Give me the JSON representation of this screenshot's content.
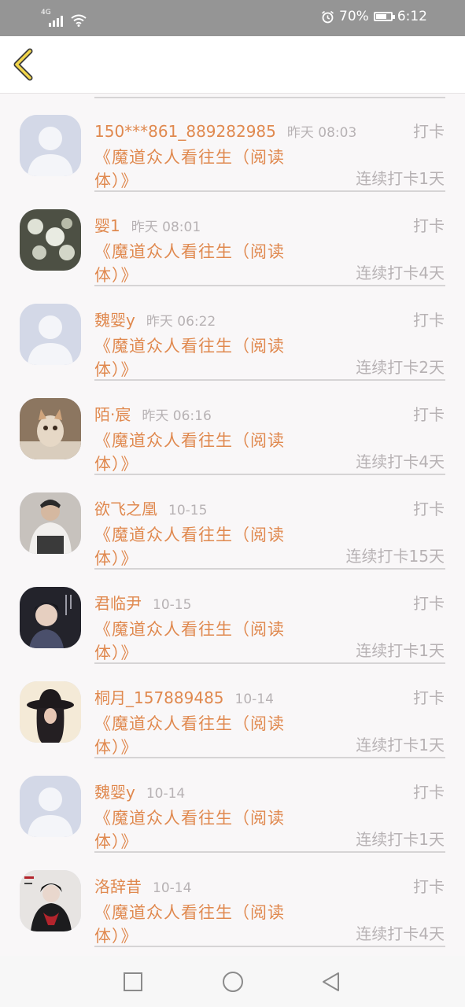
{
  "status_bar": {
    "network": "4G",
    "battery_text": "70%",
    "battery_level": 0.7,
    "time": "6:12",
    "icons": [
      "signal-icon",
      "wifi-icon",
      "alarm-icon",
      "battery-icon"
    ]
  },
  "header": {
    "back_icon": "chevron-left-icon"
  },
  "colors": {
    "accent_orange": "#e0894f",
    "muted_gray": "#b7b2b4",
    "background": "#f9f7f8",
    "back_icon_yellow": "#f2d64b"
  },
  "records": [
    {
      "name": "150***861_889282985",
      "time": "昨天 08:03",
      "action": "打卡",
      "book": "《魔道众人看往生（阅读体）》",
      "streak": "连续打卡1天",
      "avatar": "default-avatar"
    },
    {
      "name": "婴1",
      "time": "昨天 08:01",
      "action": "打卡",
      "book": "《魔道众人看往生（阅读体）》",
      "streak": "连续打卡4天",
      "avatar": "flowers-avatar"
    },
    {
      "name": "魏婴y",
      "time": "昨天 06:22",
      "action": "打卡",
      "book": "《魔道众人看往生（阅读体）》",
      "streak": "连续打卡2天",
      "avatar": "default-avatar"
    },
    {
      "name": "陌·宸",
      "time": "昨天 06:16",
      "action": "打卡",
      "book": "《魔道众人看往生（阅读体）》",
      "streak": "连续打卡4天",
      "avatar": "kitten-avatar"
    },
    {
      "name": "欲飞之凰",
      "time": "10-15",
      "action": "打卡",
      "book": "《魔道众人看往生（阅读体）》",
      "streak": "连续打卡15天",
      "avatar": "person-white-hoodie-avatar"
    },
    {
      "name": "君临尹",
      "time": "10-15",
      "action": "打卡",
      "book": "《魔道众人看往生（阅读体）》",
      "streak": "连续打卡1天",
      "avatar": "person-dark-avatar"
    },
    {
      "name": "桐月_157889485",
      "time": "10-14",
      "action": "打卡",
      "book": "《魔道众人看往生（阅读体）》",
      "streak": "连续打卡1天",
      "avatar": "hat-woman-avatar"
    },
    {
      "name": "魏婴y",
      "time": "10-14",
      "action": "打卡",
      "book": "《魔道众人看往生（阅读体）》",
      "streak": "连续打卡1天",
      "avatar": "default-avatar"
    },
    {
      "name": "洛辞昔",
      "time": "10-14",
      "action": "打卡",
      "book": "《魔道众人看往生（阅读体）》",
      "streak": "连续打卡4天",
      "avatar": "anime-character-avatar"
    }
  ],
  "nav": {
    "buttons": [
      "recent-apps-square-icon",
      "home-circle-icon",
      "back-triangle-icon"
    ]
  }
}
